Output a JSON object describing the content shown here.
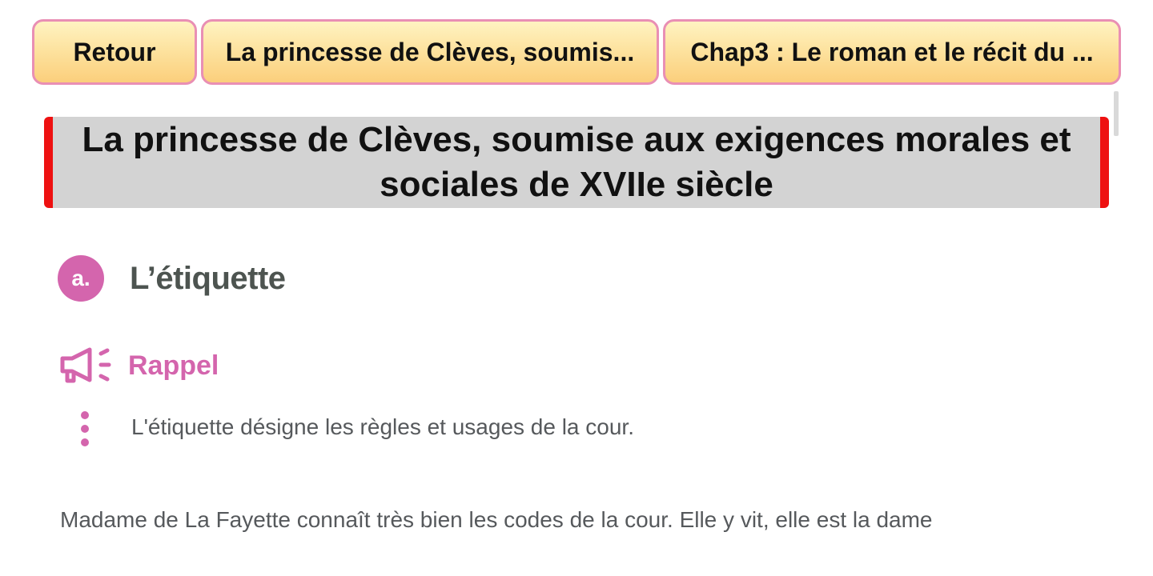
{
  "nav": {
    "back_label": "Retour",
    "lesson_label": "La princesse de Clèves, soumis...",
    "chapter_label": "Chap3 : Le roman et le récit du ..."
  },
  "title": "La princesse de Clèves, soumise aux exigences morales et sociales de XVIIe siècle",
  "section": {
    "badge": "a.",
    "heading": "L’étiquette"
  },
  "rappel": {
    "icon": "megaphone-icon",
    "label": "Rappel",
    "text": "L'étiquette désigne les règles et usages de la cour."
  },
  "body": {
    "paragraph_start": "Madame de La Fayette connaît très bien les codes de la cour. Elle y vit, elle est la dame"
  },
  "colors": {
    "accent_pink": "#d465ad",
    "nav_border": "#e98fb4",
    "nav_fill": "#fde3a0",
    "banner_bg": "#d3d3d3",
    "banner_edge": "#ee1111",
    "heading_gray": "#4d5450",
    "text_gray": "#56595c"
  }
}
